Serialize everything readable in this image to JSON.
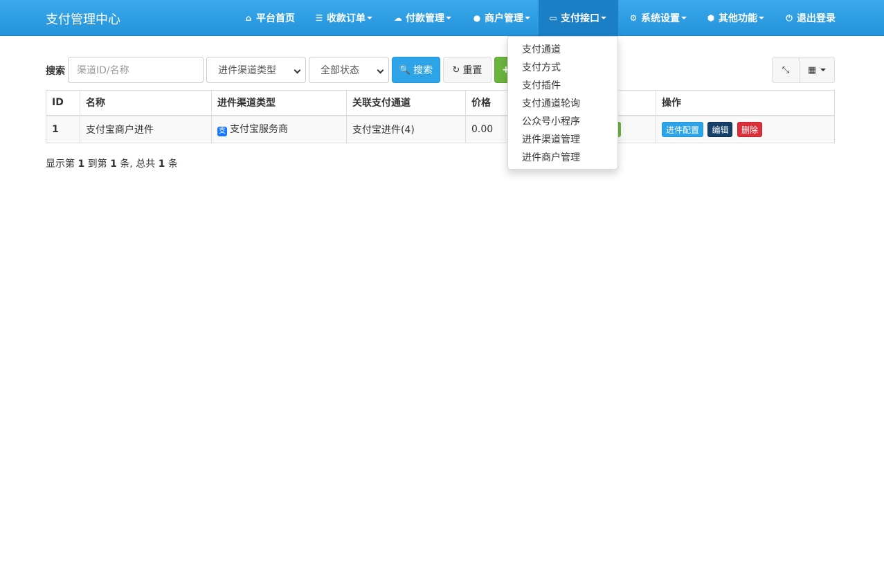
{
  "nav": {
    "brand": "支付管理中心",
    "items": [
      {
        "label": "平台首页",
        "icon": "home-icon",
        "caret": false
      },
      {
        "label": "收款订单",
        "icon": "list-icon",
        "caret": true
      },
      {
        "label": "付款管理",
        "icon": "cloud-icon",
        "caret": true
      },
      {
        "label": "商户管理",
        "icon": "user-icon",
        "caret": true
      },
      {
        "label": "支付接口",
        "icon": "credit-card-icon",
        "caret": true,
        "active": true
      },
      {
        "label": "系统设置",
        "icon": "gear-icon",
        "caret": true
      },
      {
        "label": "其他功能",
        "icon": "cube-icon",
        "caret": true
      },
      {
        "label": "退出登录",
        "icon": "power-icon",
        "caret": false
      }
    ]
  },
  "dropdown": {
    "items": [
      "支付通道",
      "支付方式",
      "支付插件",
      "支付通道轮询",
      "公众号小程序",
      "进件渠道管理",
      "进件商户管理"
    ]
  },
  "toolbar": {
    "search_label": "搜索",
    "search_placeholder": "渠道ID/名称",
    "channel_type_select": "进件渠道类型",
    "status_select": "全部状态",
    "search_button": "搜索",
    "reset_button": "重置"
  },
  "table": {
    "headers": [
      "ID",
      "名称",
      "进件渠道类型",
      "关联支付通道",
      "价格",
      "",
      "操作"
    ],
    "rows": [
      {
        "id": "1",
        "name": "支付宝商户进件",
        "channel_type": "支付宝服务商",
        "pay_channel": "支付宝进件(4)",
        "price": "0.00",
        "actions": [
          "进件配置",
          "编辑",
          "删除"
        ]
      }
    ]
  },
  "footer": {
    "prefix": "显示第",
    "from": "1",
    "mid1": "到第",
    "to": "1",
    "mid2": "条, 总共",
    "total": "1",
    "suffix": "条"
  },
  "colors": {
    "navbar": "#2ea4e8",
    "primary": "#2ea4e8",
    "success": "#6cb33f",
    "danger": "#d9303a",
    "dark": "#163f6a"
  }
}
